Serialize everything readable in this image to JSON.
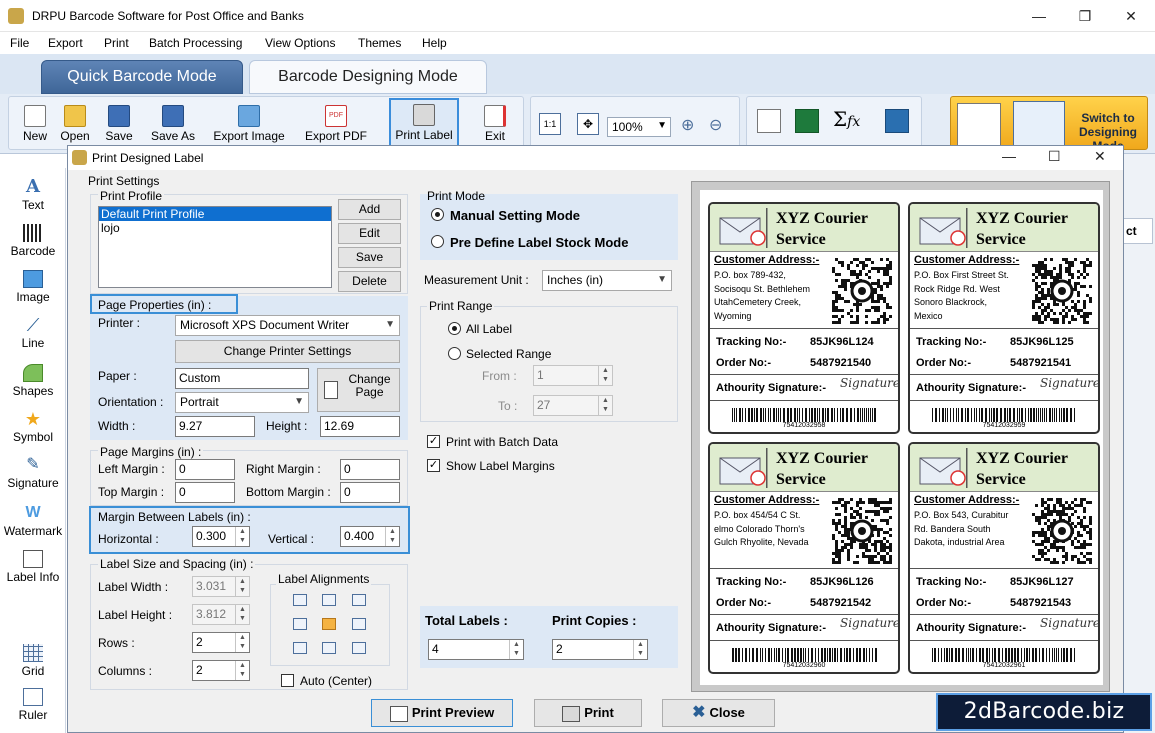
{
  "window": {
    "title": "DRPU Barcode Software for Post Office and Banks"
  },
  "menu": [
    "File",
    "Export",
    "Print",
    "Batch Processing",
    "View Options",
    "Themes",
    "Help"
  ],
  "modes": {
    "quick": "Quick Barcode Mode",
    "design": "Barcode Designing Mode"
  },
  "toolbar": {
    "new": "New",
    "open": "Open",
    "save": "Save",
    "save_as": "Save As",
    "export_image": "Export Image",
    "export_pdf": "Export PDF",
    "print_label": "Print Label",
    "exit": "Exit",
    "zoom": "100%",
    "one_to_one": "1:1",
    "switch": "Switch to Designing Mode"
  },
  "sidebar": [
    "Text",
    "Barcode",
    "Image",
    "Line",
    "Shapes",
    "Symbol",
    "Signature",
    "Watermark",
    "Label Info",
    "Grid",
    "Ruler"
  ],
  "bg_partial_label": "ct",
  "dialog": {
    "title": "Print Designed Label",
    "print_settings": "Print Settings",
    "print_profile": {
      "label": "Print Profile",
      "items": [
        "Default Print Profile",
        "lojo"
      ],
      "buttons": {
        "add": "Add",
        "edit": "Edit",
        "save": "Save",
        "delete": "Delete"
      }
    },
    "page_properties": {
      "label": "Page Properties (in) :",
      "printer_label": "Printer :",
      "printer": "Microsoft XPS Document Writer",
      "change_printer": "Change Printer Settings",
      "paper_label": "Paper :",
      "paper": "Custom",
      "change_page": "Change Page",
      "orientation_label": "Orientation :",
      "orientation": "Portrait",
      "width_label": "Width :",
      "width": "9.27",
      "height_label": "Height :",
      "height": "12.69"
    },
    "page_margins": {
      "label": "Page Margins (in) :",
      "left_label": "Left Margin :",
      "left": "0",
      "right_label": "Right Margin :",
      "right": "0",
      "top_label": "Top Margin :",
      "top": "0",
      "bottom_label": "Bottom Margin :",
      "bottom": "0"
    },
    "margin_between": {
      "label": "Margin Between Labels (in) :",
      "horizontal_label": "Horizontal :",
      "horizontal": "0.300",
      "vertical_label": "Vertical :",
      "vertical": "0.400"
    },
    "label_size": {
      "label": "Label Size and Spacing (in) :",
      "width_label": "Label Width :",
      "width": "3.031",
      "height_label": "Label Height :",
      "height": "3.812",
      "rows_label": "Rows :",
      "rows": "2",
      "columns_label": "Columns :",
      "columns": "2",
      "alignments_label": "Label Alignments",
      "auto_center": "Auto (Center)"
    },
    "print_mode": {
      "label": "Print Mode",
      "manual": "Manual Setting Mode",
      "predefined": "Pre Define Label Stock Mode"
    },
    "measurement": {
      "label": "Measurement Unit :",
      "value": "Inches (in)"
    },
    "print_range": {
      "label": "Print Range",
      "all": "All Label",
      "selected": "Selected Range",
      "from_label": "From :",
      "from": "1",
      "to_label": "To :",
      "to": "27"
    },
    "print_batch": "Print with Batch Data",
    "show_margins": "Show Label Margins",
    "totals": {
      "total_label": "Total Labels :",
      "total": "4",
      "copies_label": "Print Copies :",
      "copies": "2"
    },
    "buttons": {
      "preview": "Print Preview",
      "print": "Print",
      "close": "Close"
    }
  },
  "labels": [
    {
      "company": "XYZ Courier Service",
      "addr_title": "Customer Address:-",
      "address": [
        "P.O. box 789-432,",
        "Socisoqu St. Bethlehem",
        "UtahCemetery Creek,",
        "Wyoming"
      ],
      "tracking_label": "Tracking No:-",
      "tracking": "85JK96L124",
      "order_label": "Order No:-",
      "order": "5487921540",
      "sign_label": "Athourity Signature:-",
      "signature": "Signature",
      "barcode": "75412032958"
    },
    {
      "company": "XYZ Courier Service",
      "addr_title": "Customer Address:-",
      "address": [
        "P.O. Box First Street St.",
        "Rock Ridge Rd. West",
        "Sonoro Blackrock,",
        "Mexico"
      ],
      "tracking_label": "Tracking No:-",
      "tracking": "85JK96L125",
      "order_label": "Order No:-",
      "order": "5487921541",
      "sign_label": "Athourity Signature:-",
      "signature": "Signature",
      "barcode": "75412032959"
    },
    {
      "company": "XYZ Courier Service",
      "addr_title": "Customer Address:-",
      "address": [
        "P.O. box 454/54 C St.",
        "elmo Colorado Thorn's",
        "Gulch Rhyolite, Nevada",
        ""
      ],
      "tracking_label": "Tracking No:-",
      "tracking": "85JK96L126",
      "order_label": "Order No:-",
      "order": "5487921542",
      "sign_label": "Athourity Signature:-",
      "signature": "Signature",
      "barcode": "75412032960"
    },
    {
      "company": "XYZ Courier Service",
      "addr_title": "Customer Address:-",
      "address": [
        "P.O. Box 543, Curabitur",
        "Rd. Bandera South",
        "Dakota, industrial Area",
        ""
      ],
      "tracking_label": "Tracking No:-",
      "tracking": "85JK96L127",
      "order_label": "Order No:-",
      "order": "5487921543",
      "sign_label": "Athourity Signature:-",
      "signature": "Signature",
      "barcode": "75412032961"
    }
  ],
  "watermark": "2dBarcode.biz"
}
